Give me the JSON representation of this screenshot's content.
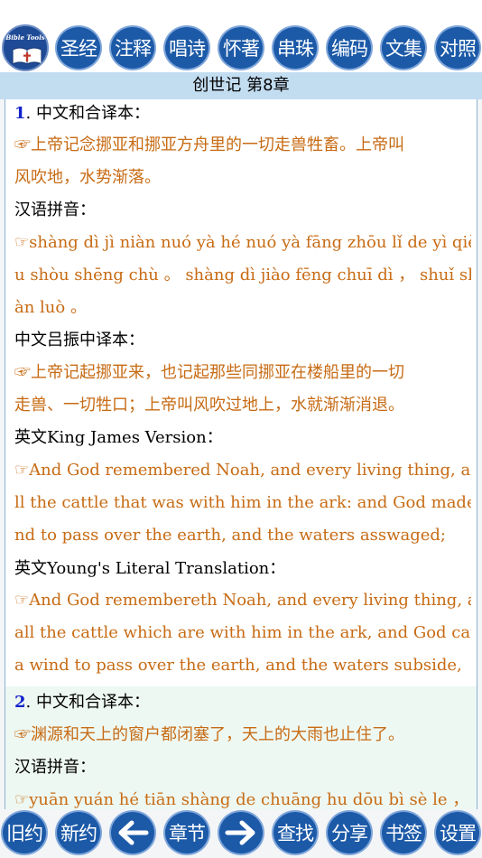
{
  "toolbar": {
    "logo_text": "Bible Tools",
    "buttons": [
      "圣经",
      "注释",
      "唱诗",
      "怀著",
      "串珠",
      "编码",
      "文集",
      "对照"
    ]
  },
  "chapter_title": "创世记 第8章",
  "verses": [
    {
      "number": "1",
      "lines": [
        {
          "kind": "label",
          "text": ". 中文和合译本："
        },
        {
          "kind": "text",
          "text": "☞上帝记念挪亚和挪亚方舟里的一切走兽牲畜。上帝叫"
        },
        {
          "kind": "text",
          "text": "风吹地，水势渐落。"
        },
        {
          "kind": "label",
          "text": "汉语拼音："
        },
        {
          "kind": "text",
          "text": "☞shàng dì jì niàn nuó yà hé nuó yà fāng zhōu lǐ de yì qiè zǒ"
        },
        {
          "kind": "text",
          "text": "u shòu shēng chù 。 shàng dì jiào fēng chuī dì ， shuǐ shì ji"
        },
        {
          "kind": "text",
          "text": "àn luò 。"
        },
        {
          "kind": "label",
          "text": "中文吕振中译本："
        },
        {
          "kind": "text",
          "text": "☞上帝记起挪亚来，也记起那些同挪亚在楼船里的一切"
        },
        {
          "kind": "text",
          "text": "走兽、一切牲口；上帝叫风吹过地上，水就渐渐消退。"
        },
        {
          "kind": "label",
          "text": "英文King James Version："
        },
        {
          "kind": "text",
          "text": "☞And God remembered Noah, and every living thing, and a"
        },
        {
          "kind": "text",
          "text": "ll the cattle that was with him in the ark: and God made a wi"
        },
        {
          "kind": "text",
          "text": "nd to pass over the earth, and the waters asswaged;"
        },
        {
          "kind": "label",
          "text": "英文Young's Literal Translation："
        },
        {
          "kind": "text",
          "text": "☞And God remembereth Noah, and every living thing, and"
        },
        {
          "kind": "text",
          "text": "all the cattle which are with him in the ark, and God causeth"
        },
        {
          "kind": "text",
          "text": "a wind to pass over the earth, and the waters subside,"
        }
      ]
    },
    {
      "number": "2",
      "lines": [
        {
          "kind": "label",
          "text": ". 中文和合译本："
        },
        {
          "kind": "text",
          "text": "☞渊源和天上的窗户都闭塞了，天上的大雨也止住了。"
        },
        {
          "kind": "label",
          "text": "汉语拼音："
        },
        {
          "kind": "text",
          "text": "☞yuān yuán hé tiān shàng de chuāng hu dōu bì sè le ， tiān"
        }
      ]
    }
  ],
  "bottom_bar": {
    "old_testament": "旧约",
    "new_testament": "新约",
    "chapter": "章节",
    "search": "查找",
    "share": "分享",
    "bookmark": "书签",
    "settings": "设置"
  },
  "colors": {
    "button": "#1c5aa8",
    "title_strip": "#c2dcf0",
    "verse_text": "#c76b14",
    "verse_number": "#1122cc"
  }
}
